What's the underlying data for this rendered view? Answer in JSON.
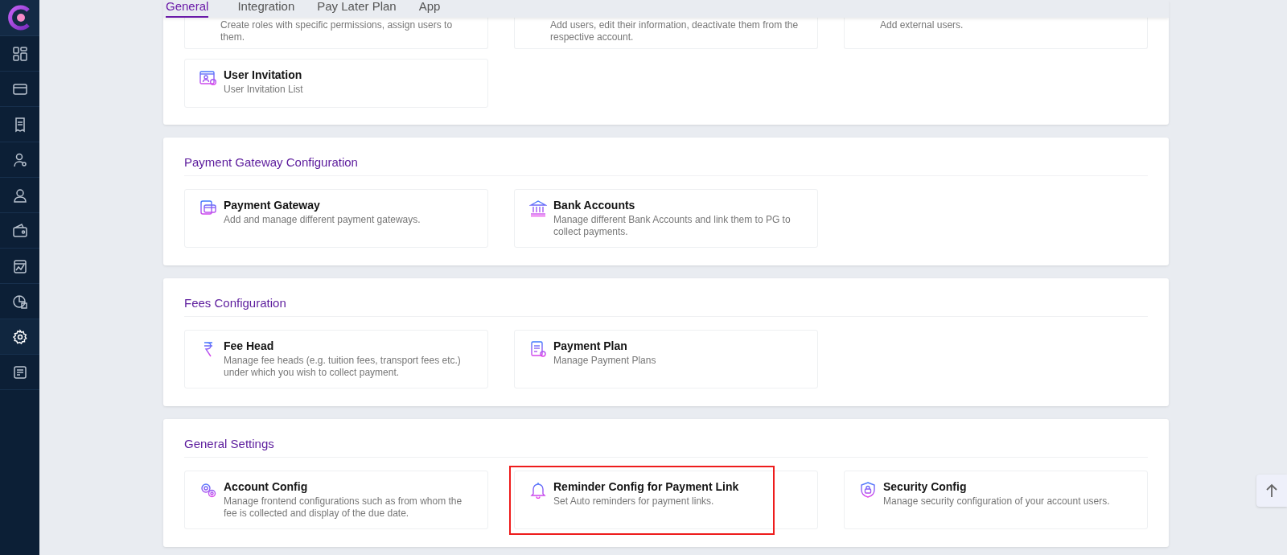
{
  "sidebar": {
    "items": [
      {
        "selected": false
      },
      {
        "selected": false
      },
      {
        "selected": false
      },
      {
        "selected": false
      },
      {
        "selected": false
      },
      {
        "selected": false
      },
      {
        "selected": false
      },
      {
        "selected": false
      },
      {
        "selected": true
      },
      {
        "selected": false
      }
    ]
  },
  "tabs": [
    {
      "label": "General",
      "selected": true
    },
    {
      "label": "Integration",
      "selected": false
    },
    {
      "label": "Pay Later Plan",
      "selected": false
    },
    {
      "label": "App",
      "selected": false
    }
  ],
  "sections": [
    {
      "cards": [
        {
          "description": "Create roles with specific permissions, assign users to them."
        },
        {
          "description": "Add users, edit their information, deactivate them from the respective account."
        },
        {
          "description": "Add external users."
        },
        {
          "title": "User Invitation",
          "description": "User Invitation List",
          "highlighted": false
        }
      ]
    },
    {
      "title": "Payment Gateway Configuration",
      "cards": [
        {
          "title": "Payment Gateway",
          "description": "Add and manage different payment gateways.",
          "highlighted": false
        },
        {
          "title": "Bank Accounts",
          "description": "Manage different Bank Accounts and link them to PG to collect payments.",
          "highlighted": false
        }
      ]
    },
    {
      "title": "Fees Configuration",
      "cards": [
        {
          "title": "Fee Head",
          "description": "Manage fee heads (e.g. tuition fees, transport fees etc.) under which you wish to collect payment.",
          "highlighted": false
        },
        {
          "title": "Payment Plan",
          "description": "Manage Payment Plans",
          "highlighted": false
        }
      ]
    },
    {
      "title": "General Settings",
      "cards": [
        {
          "title": "Account Config",
          "description": "Manage frontend configurations such as from whom the fee is collected and display of the due date.",
          "highlighted": false
        },
        {
          "title": "Reminder Config for Payment Link",
          "description": "Set Auto reminders for payment links.",
          "highlighted": true
        },
        {
          "title": "Security Config",
          "description": "Manage security configuration of your account users.",
          "highlighted": false
        }
      ]
    }
  ]
}
